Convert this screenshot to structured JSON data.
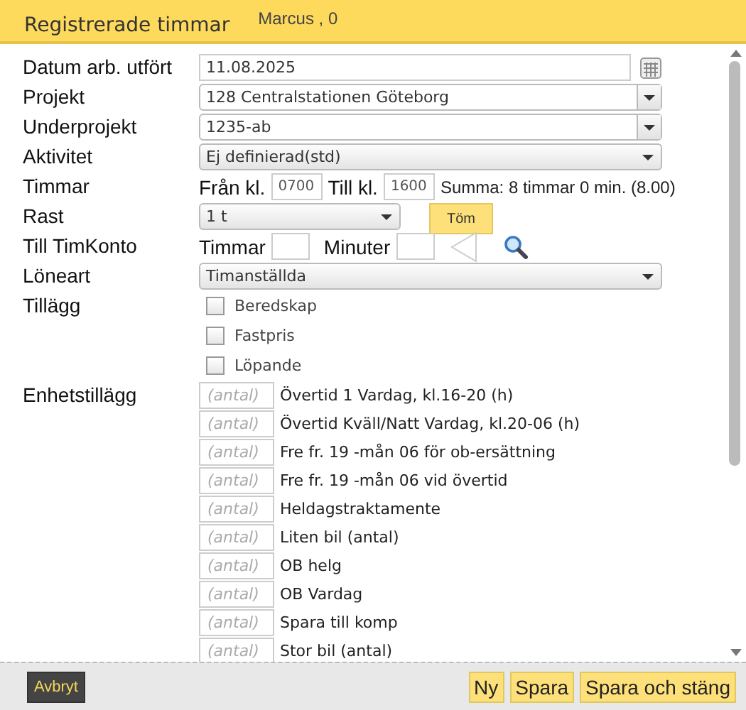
{
  "header": {
    "title": "Registrerade timmar",
    "user": "Marcus , 0"
  },
  "form": [
    {
      "kind": "date",
      "label": "Datum arb. utfört",
      "value": "11.08.2025"
    },
    {
      "kind": "select",
      "label": "Projekt",
      "value": "128 Centralstationen Göteborg"
    },
    {
      "kind": "select",
      "label": "Underprojekt",
      "value": "1235-ab"
    },
    {
      "kind": "dropdown",
      "label": "Aktivitet",
      "value": "Ej definierad(std)"
    },
    {
      "kind": "hours",
      "label": "Timmar",
      "from_label": "Från kl.",
      "from": "0700",
      "to_label": "Till kl.",
      "to": "1600",
      "summary": "Summa: 8 timmar 0 min. (8.00)"
    },
    {
      "kind": "break",
      "label": "Rast",
      "value": "1 t",
      "button": "Töm"
    },
    {
      "kind": "account",
      "label": "Till TimKonto",
      "hours_label": "Timmar",
      "minutes_label": "Minuter"
    },
    {
      "kind": "dropdown",
      "label": "Löneart",
      "value": "Timanställda"
    },
    {
      "kind": "checks",
      "label": "Tillägg",
      "options": [
        {
          "text": "Beredskap",
          "checked": false
        },
        {
          "text": "Fastpris",
          "checked": false
        },
        {
          "text": "Löpande",
          "checked": false
        }
      ]
    },
    {
      "kind": "units",
      "label": "Enhetstillägg",
      "items": [
        {
          "placeholder": "(antal)",
          "text": "Övertid 1 Vardag, kl.16-20 (h)"
        },
        {
          "placeholder": "(antal)",
          "text": "Övertid Kväll/Natt Vardag, kl.20-06 (h)"
        },
        {
          "placeholder": "(antal)",
          "text": "Fre fr. 19 -mån 06 för ob-ersättning"
        },
        {
          "placeholder": "(antal)",
          "text": "Fre fr. 19 -mån 06 vid övertid"
        },
        {
          "placeholder": "(antal)",
          "text": "Heldagstraktamente"
        },
        {
          "placeholder": "(antal)",
          "text": "Liten bil (antal)"
        },
        {
          "placeholder": "(antal)",
          "text": "OB helg"
        },
        {
          "placeholder": "(antal)",
          "text": "OB Vardag"
        },
        {
          "placeholder": "(antal)",
          "text": "Spara till komp"
        },
        {
          "placeholder": "(antal)",
          "text": "Stor bil (antal)"
        }
      ]
    }
  ],
  "footer": {
    "cancel": "Avbryt",
    "buttons": [
      "Ny",
      "Spara",
      "Spara och stäng"
    ]
  }
}
